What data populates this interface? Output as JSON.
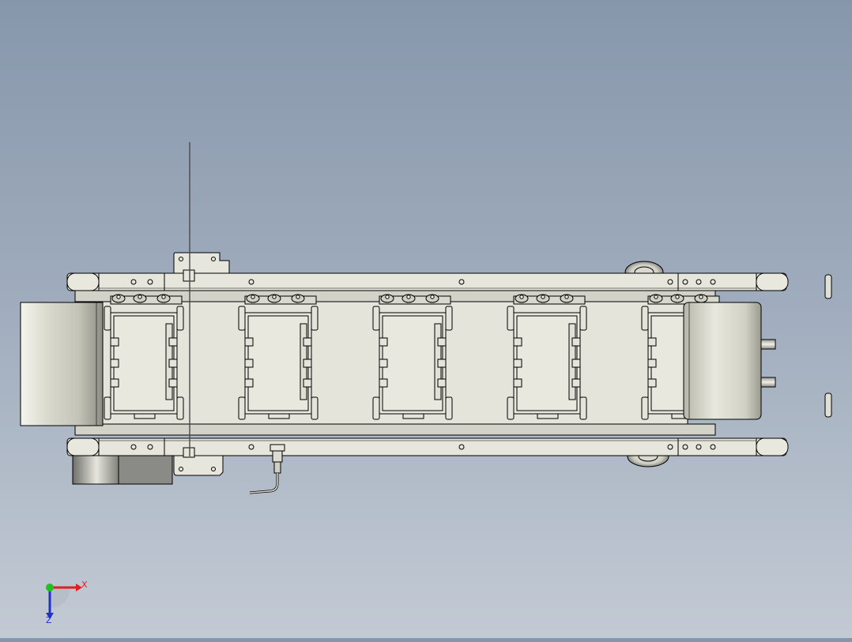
{
  "window": {
    "background_top": "#8797ab",
    "background_bottom": "#c3cad4"
  },
  "model": {
    "view": "top",
    "body_color": "#e6e6dc",
    "motor_color": "#8a8a87",
    "outline_color": "#000000",
    "carrier_count": 5
  },
  "triad": {
    "x_label": "X",
    "z_label": "Z",
    "x_axis_color": "#e02020",
    "y_axis_color": "#20c020",
    "z_axis_color": "#2030d0"
  }
}
